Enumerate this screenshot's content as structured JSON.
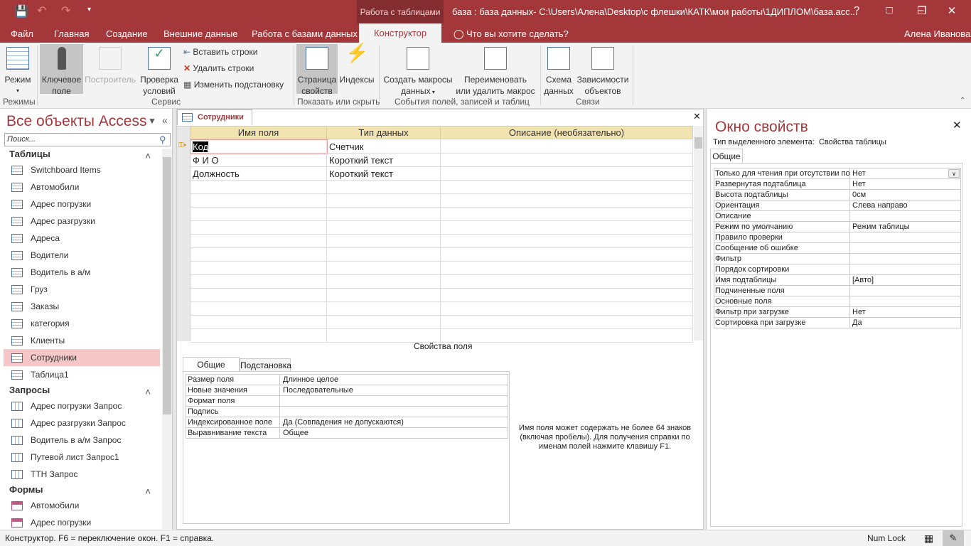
{
  "titlebar": {
    "context_tab": "Работа с таблицами",
    "title": "база : база данных- C:\\Users\\Алена\\Desktop\\с флешки\\КАТК\\мои работы\\1ДИПЛОМ\\база.асс...",
    "help": "?"
  },
  "tabs": {
    "file": "Файл",
    "home": "Главная",
    "create": "Создание",
    "external": "Внешние данные",
    "db": "Работа с базами данных",
    "design": "Конструктор",
    "tell": "Что вы хотите сделать?",
    "user": "Алена Иванова"
  },
  "ribbon": {
    "mode": "Режим",
    "key1": "Ключевое",
    "key2": "поле",
    "builder": "Построитель",
    "check1": "Проверка",
    "check2": "условий",
    "insert_rows": "Вставить строки",
    "delete_rows": "Удалить строки",
    "modify_lookup": "Изменить подстановку",
    "props1": "Страница",
    "props2": "свойств",
    "indexes": "Индексы",
    "macros1": "Создать макросы",
    "macros2": "данных",
    "rename1": "Переименовать",
    "rename2": "или удалить макрос",
    "schema1": "Схема",
    "schema2": "данных",
    "deps1": "Зависимости",
    "deps2": "объектов",
    "groups": {
      "modes": "Режимы",
      "service": "Сервис",
      "showhide": "Показать или скрыть",
      "events": "События полей, записей и таблиц",
      "relations": "Связи"
    }
  },
  "nav": {
    "title": "Все объекты Access",
    "search_placeholder": "Поиск...",
    "sections": {
      "tables": "Таблицы",
      "queries": "Запросы",
      "forms": "Формы"
    },
    "tables": [
      "Switchboard Items",
      "Автомобили",
      "Адрес погрузки",
      "Адрес разгрузки",
      "Адреса",
      "Водители",
      "Водитель в а/м",
      "Груз",
      "Заказы",
      "категория",
      "Клиенты",
      "Сотрудники",
      "Таблица1"
    ],
    "queries": [
      "Адрес погрузки Запрос",
      "Адрес разгрузки Запрос",
      "Водитель в а/м Запрос",
      "Путевой лист Запрос1",
      "ТТН Запрос"
    ],
    "forms": [
      "Автомобили",
      "Адрес погрузки"
    ],
    "selected": "Сотрудники"
  },
  "doc": {
    "tab": "Сотрудники",
    "headers": [
      "Имя поля",
      "Тип данных",
      "Описание (необязательно)"
    ],
    "rows": [
      [
        "Код",
        "Счетчик",
        ""
      ],
      [
        "Ф И О",
        "Короткий текст",
        ""
      ],
      [
        "Должность",
        "Короткий текст",
        ""
      ]
    ],
    "field_props_title": "Свойства поля",
    "fp_tabs": [
      "Общие",
      "Подстановка"
    ],
    "fp_rows": [
      [
        "Размер поля",
        "Длинное целое"
      ],
      [
        "Новые значения",
        "Последовательные"
      ],
      [
        "Формат поля",
        ""
      ],
      [
        "Подпись",
        ""
      ],
      [
        "Индексированное поле",
        "Да (Совпадения не допускаются)"
      ],
      [
        "Выравнивание текста",
        "Общее"
      ]
    ],
    "hint": "Имя поля может содержать не более 64 знаков (включая пробелы). Для получения справки по именам полей нажмите клавишу F1."
  },
  "props": {
    "title": "Окно свойств",
    "sel_type_label": "Тип выделенного элемента:",
    "sel_type": "Свойства таблицы",
    "tab": "Общие",
    "rows": [
      [
        "Только для чтения при отсутствии подключения",
        "Нет"
      ],
      [
        "Развернутая подтаблица",
        "Нет"
      ],
      [
        "Высота подтаблицы",
        "0см"
      ],
      [
        "Ориентация",
        "Слева направо"
      ],
      [
        "Описание",
        ""
      ],
      [
        "Режим по умолчанию",
        "Режим таблицы"
      ],
      [
        "Правило проверки",
        ""
      ],
      [
        "Сообщение об ошибке",
        ""
      ],
      [
        "Фильтр",
        ""
      ],
      [
        "Порядок сортировки",
        ""
      ],
      [
        "Имя подтаблицы",
        "[Авто]"
      ],
      [
        "Подчиненные поля",
        ""
      ],
      [
        "Основные поля",
        ""
      ],
      [
        "Фильтр при загрузке",
        "Нет"
      ],
      [
        "Сортировка при загрузке",
        "Да"
      ]
    ]
  },
  "status": {
    "left": "Конструктор.  F6 = переключение окон.  F1 = справка.",
    "numlock": "Num Lock"
  },
  "colors": {
    "accent": "#a4373a",
    "selected": "#f7c6c7",
    "header": "#f2e4b1"
  }
}
